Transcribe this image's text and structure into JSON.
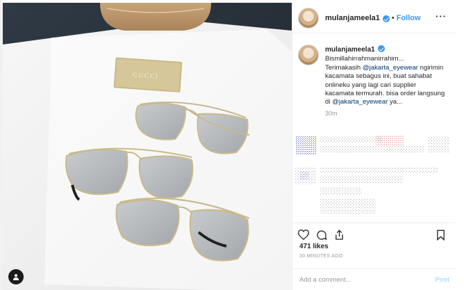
{
  "post": {
    "photo_alt": "",
    "logo_text": "GUCCI"
  },
  "header": {
    "username": "mulanjameela1",
    "separator": "•",
    "follow_label": "Follow",
    "more_label": "···"
  },
  "caption": {
    "username": "mulanjameela1",
    "line1": "Bismillahirrahmanirrahim...",
    "text_a": "Terimakasih ",
    "mention1": "@jakarta_eyewear",
    "text_b": " ngirimin kacamata sebagus ini, buat sahabat onlineku yang lagi cari supplier kacamata termurah. bisa order langsung di ",
    "mention2": "@jakarta_eyewear",
    "text_c": " ya...",
    "time": "30m"
  },
  "actions": {
    "like_icon": "heart-icon",
    "comment_icon": "comment-icon",
    "share_icon": "share-icon",
    "save_icon": "bookmark-icon"
  },
  "stats": {
    "likes": "471 likes",
    "posted": "30 MINUTES AGO"
  },
  "comment_box": {
    "placeholder": "Add a comment...",
    "post_label": "Post"
  },
  "colors": {
    "accent": "#3897f0",
    "muted": "#999999",
    "border": "#efefef"
  }
}
